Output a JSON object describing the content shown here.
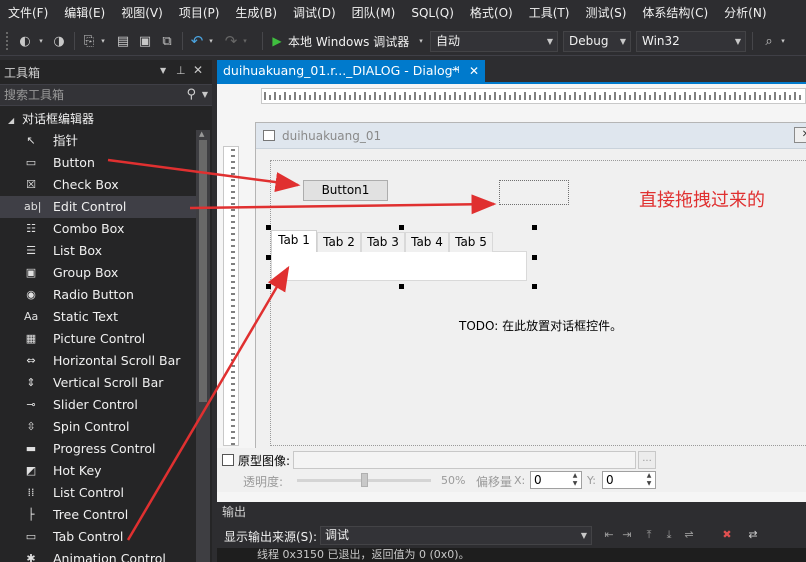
{
  "menu": [
    "文件(F)",
    "编辑(E)",
    "视图(V)",
    "项目(P)",
    "生成(B)",
    "调试(D)",
    "团队(M)",
    "SQL(Q)",
    "格式(O)",
    "工具(T)",
    "测试(S)",
    "体系结构(C)",
    "分析(N)"
  ],
  "toolbar": {
    "run_label": "本地 Windows 调试器",
    "solution_config": "自动",
    "build_config": "Debug",
    "platform": "Win32"
  },
  "toolbox": {
    "title": "工具箱",
    "search_placeholder": "搜索工具箱",
    "group": "对话框编辑器",
    "items": [
      {
        "label": "指针",
        "icon": "pointer-icon",
        "glyph": "↖"
      },
      {
        "label": "Button",
        "icon": "button-icon",
        "glyph": "▭"
      },
      {
        "label": "Check Box",
        "icon": "checkbox-icon",
        "glyph": "☒"
      },
      {
        "label": "Edit Control",
        "icon": "edit-control-icon",
        "glyph": "ab|"
      },
      {
        "label": "Combo Box",
        "icon": "combo-box-icon",
        "glyph": "☷"
      },
      {
        "label": "List Box",
        "icon": "list-box-icon",
        "glyph": "☰"
      },
      {
        "label": "Group Box",
        "icon": "group-box-icon",
        "glyph": "▣"
      },
      {
        "label": "Radio Button",
        "icon": "radio-button-icon",
        "glyph": "◉"
      },
      {
        "label": "Static Text",
        "icon": "static-text-icon",
        "glyph": "Aa"
      },
      {
        "label": "Picture Control",
        "icon": "picture-control-icon",
        "glyph": "▦"
      },
      {
        "label": "Horizontal Scroll Bar",
        "icon": "hscroll-icon",
        "glyph": "⇔"
      },
      {
        "label": "Vertical Scroll Bar",
        "icon": "vscroll-icon",
        "glyph": "⇕"
      },
      {
        "label": "Slider Control",
        "icon": "slider-icon",
        "glyph": "⊸"
      },
      {
        "label": "Spin Control",
        "icon": "spin-icon",
        "glyph": "⇳"
      },
      {
        "label": "Progress Control",
        "icon": "progress-icon",
        "glyph": "▬"
      },
      {
        "label": "Hot Key",
        "icon": "hotkey-icon",
        "glyph": "◩"
      },
      {
        "label": "List Control",
        "icon": "list-control-icon",
        "glyph": "⁞⁞"
      },
      {
        "label": "Tree Control",
        "icon": "tree-control-icon",
        "glyph": "├"
      },
      {
        "label": "Tab Control",
        "icon": "tab-control-icon",
        "glyph": "▭"
      },
      {
        "label": "Animation Control",
        "icon": "animation-control-icon",
        "glyph": "✱"
      }
    ],
    "selected_index": 3
  },
  "document": {
    "tab_title": "duihuakuang_01.r..._DIALOG - Dialog*"
  },
  "dialog": {
    "title": "duihuakuang_01",
    "button_label": "Button1",
    "tabs": [
      "Tab 1",
      "Tab 2",
      "Tab 3",
      "Tab 4",
      "Tab 5"
    ],
    "active_tab": 0,
    "todo": "TODO: 在此放置对话框控件。"
  },
  "annotation": "直接拖拽过来的",
  "annotation_color": "#e03030",
  "editor_controls": {
    "prototype_label": "原型图像:",
    "opacity_label": "透明度:",
    "opacity_value": "50%",
    "opacity_level": 0.5,
    "offset_label": "偏移量",
    "x_label": "X:",
    "x_value": "0",
    "y_label": "Y:",
    "y_value": "0"
  },
  "output": {
    "title": "输出",
    "source_label": "显示输出来源(S):",
    "source_value": "调试",
    "visible_line": "线程 0x3150 已退出，返回值为 0 (0x0)。"
  },
  "colors": {
    "accent": "#007acc",
    "ide_background": "#2d2d30",
    "toolbox_background": "#252526"
  }
}
